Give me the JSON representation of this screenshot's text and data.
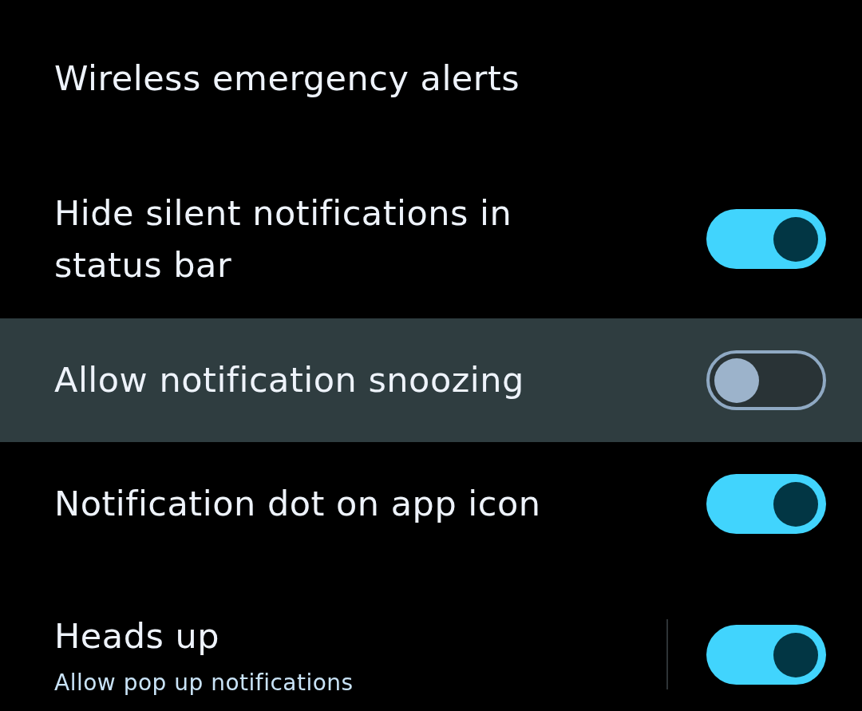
{
  "items": [
    {
      "kind": "link",
      "title": "Wireless emergency alerts",
      "selected": false
    },
    {
      "kind": "switch",
      "title": "Hide silent notifications in status bar",
      "on": true,
      "selected": false
    },
    {
      "kind": "switch",
      "title": "Allow notification snoozing",
      "on": false,
      "selected": true
    },
    {
      "kind": "switch",
      "title": "Notification dot on app icon",
      "on": true,
      "selected": false
    },
    {
      "kind": "split-switch",
      "title": "Heads up",
      "subtitle": "Allow pop up notifications",
      "on": true,
      "selected": false
    }
  ]
}
